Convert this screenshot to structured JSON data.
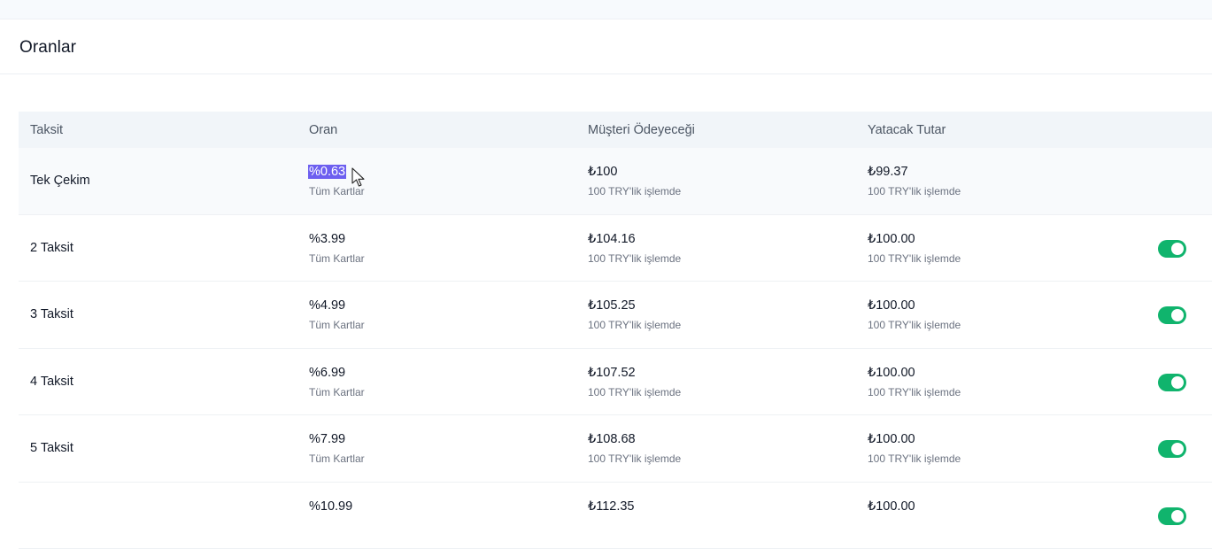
{
  "page": {
    "title": "Oranlar"
  },
  "table": {
    "headers": [
      "Taksit",
      "Oran",
      "Müşteri Ödeyeceği",
      "Yatacak Tutar"
    ],
    "rows": [
      {
        "taksit": "Tek Çekim",
        "oran": "%0.63",
        "oran_sub": "Tüm Kartlar",
        "musteri": "₺100",
        "musteri_sub": "100 TRY'lik işlemde",
        "yatacak": "₺99.37",
        "yatacak_sub": "100 TRY'lik işlemde",
        "toggle": null,
        "highlighted": true
      },
      {
        "taksit": "2 Taksit",
        "oran": "%3.99",
        "oran_sub": "Tüm Kartlar",
        "musteri": "₺104.16",
        "musteri_sub": "100 TRY'lik işlemde",
        "yatacak": "₺100.00",
        "yatacak_sub": "100 TRY'lik işlemde",
        "toggle": true
      },
      {
        "taksit": "3 Taksit",
        "oran": "%4.99",
        "oran_sub": "Tüm Kartlar",
        "musteri": "₺105.25",
        "musteri_sub": "100 TRY'lik işlemde",
        "yatacak": "₺100.00",
        "yatacak_sub": "100 TRY'lik işlemde",
        "toggle": true
      },
      {
        "taksit": "4 Taksit",
        "oran": "%6.99",
        "oran_sub": "Tüm Kartlar",
        "musteri": "₺107.52",
        "musteri_sub": "100 TRY'lik işlemde",
        "yatacak": "₺100.00",
        "yatacak_sub": "100 TRY'lik işlemde",
        "toggle": true
      },
      {
        "taksit": "5 Taksit",
        "oran": "%7.99",
        "oran_sub": "Tüm Kartlar",
        "musteri": "₺108.68",
        "musteri_sub": "100 TRY'lik işlemde",
        "yatacak": "₺100.00",
        "yatacak_sub": "100 TRY'lik işlemde",
        "toggle": true
      },
      {
        "taksit": "",
        "oran": "%10.99",
        "oran_sub": "",
        "musteri": "₺112.35",
        "musteri_sub": "",
        "yatacak": "₺100.00",
        "yatacak_sub": "",
        "toggle": true
      }
    ]
  },
  "colors": {
    "toggle_on": "#10b46d",
    "selection": "#6d5ff0",
    "header_bg": "#f1f5f9"
  },
  "icons": {
    "cursor": "mouse-pointer-icon",
    "toggle": "toggle-switch-icon"
  }
}
